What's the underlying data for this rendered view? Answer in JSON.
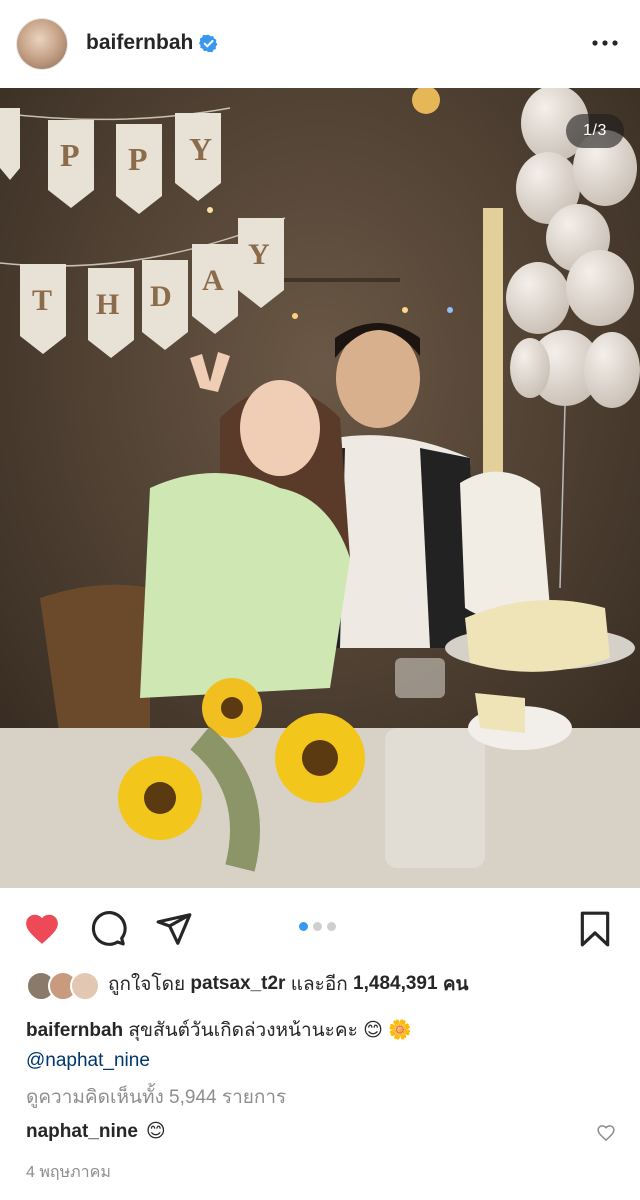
{
  "header": {
    "username": "baifernbah",
    "verified": true,
    "more_icon": "more-horizontal-icon"
  },
  "photo": {
    "counter": "1/3",
    "banner_letters_top": [
      "P",
      "P",
      "Y"
    ],
    "banner_letters_bottom": [
      "T",
      "H",
      "D",
      "A",
      "Y"
    ]
  },
  "actions": {
    "like_icon": "heart-filled-icon",
    "comment_icon": "comment-bubble-icon",
    "share_icon": "paper-plane-icon",
    "save_icon": "bookmark-icon",
    "carousel_count": 3,
    "carousel_active": 0,
    "like_color": "#ed4956"
  },
  "likes": {
    "prefix": "ถูกใจโดย",
    "liker": "patsax_t2r",
    "middle": "และอีก",
    "count": "1,484,391",
    "suffix": "คน"
  },
  "caption": {
    "username": "baifernbah",
    "text": "สุขสันต์วันเกิดล่วงหน้านะคะ",
    "emojis": "😊 🌼",
    "mention": "@naphat_nine"
  },
  "comments": {
    "view_all": "ดูความคิดเห็นทั้ง 5,944 รายการ",
    "top_comment_user": "naphat_nine",
    "top_comment_text": "😊"
  },
  "date": "4 พฤษภาคม",
  "colors": {
    "text": "#262626",
    "secondary": "#8e8e8e",
    "mention": "#00376b",
    "verified": "#3897f0",
    "dot_active": "#3897f0"
  }
}
